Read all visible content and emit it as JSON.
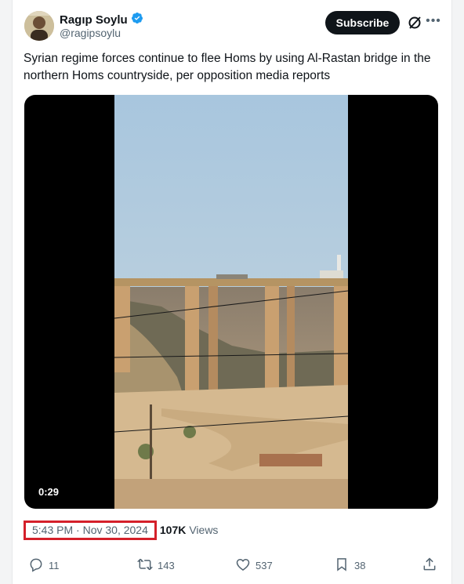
{
  "author": {
    "name": "Ragıp Soylu",
    "handle": "@ragipsoylu",
    "verified": true
  },
  "header": {
    "subscribe_label": "Subscribe"
  },
  "tweet": {
    "text": "Syrian regime forces continue to flee Homs by using Al-Rastan bridge in the northern Homs countryside, per opposition media reports",
    "video_duration": "0:29",
    "timestamp": "5:43 PM · Nov 30, 2024",
    "views_count": "107K",
    "views_label": "Views"
  },
  "actions": {
    "replies": "11",
    "reposts": "143",
    "likes": "537",
    "bookmarks": "38"
  },
  "colors": {
    "verified": "#1d9bf0",
    "highlight": "#d4202a",
    "muted": "#536471",
    "text": "#0f1419"
  },
  "icons": [
    "verified-icon",
    "grok-icon",
    "more-icon",
    "reply-icon",
    "repost-icon",
    "like-icon",
    "bookmark-icon",
    "share-icon"
  ]
}
